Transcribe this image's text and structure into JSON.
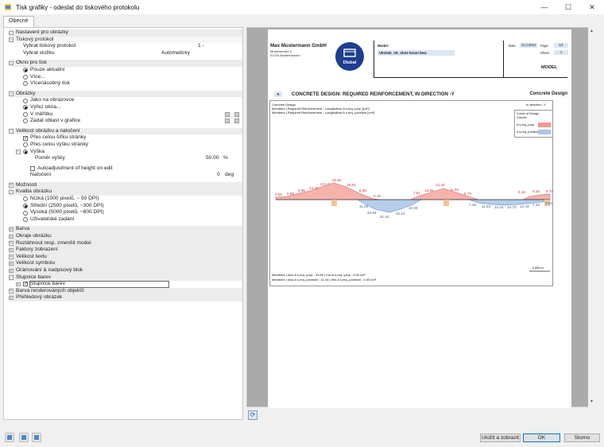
{
  "window": {
    "title": "Tisk grafiky - odeslat do tiskového protokolu",
    "minimize": "—",
    "maximize": "☐",
    "close": "✕"
  },
  "tabs": [
    {
      "label": "Obecné"
    }
  ],
  "settings": {
    "nastaveni": "Nastavení pro obrázky",
    "tiskovy_protokol": "Tiskový protokol",
    "vybrat_protokol": "Vybrat tiskový protokol",
    "vybrat_protokol_val": "1 -",
    "vybrat_slozku": "Vybrat složku",
    "vybrat_slozku_val": "Automaticky",
    "okno_pro_tisk": "Okno pro tisk",
    "pouze_aktualni": "Pouze aktuální",
    "vice": "Více...",
    "vicenasobny": "Vícenásobný tisk",
    "obrazky": "Obrázky",
    "jako_na_obrazovce": "Jako na obrazovce",
    "vyrez_okna": "Výřez okna...",
    "v_meritku": "V měřítku",
    "zadat_oblast": "Zadat oblast v grafice",
    "velikost_obrazku": "Velikost obrázku a natočení",
    "pres_celou_sirku": "Přes celou šířku stránky",
    "pres_celou_vysku": "Přes celou výšku stránky",
    "vyska": "Výška",
    "pomer_vysky": "Poměr výšky",
    "pomer_vysky_val": "50.00",
    "pomer_vysky_unit": "%",
    "autoadjustment": "Autoadjustment of height on edit",
    "natoceni": "Natočení",
    "natoceni_val": "0",
    "natoceni_unit": "deg",
    "moznosti": "Možnosti",
    "kvalita": "Kvalita obrázku",
    "nizka": "Nízká (1000 pixelů, ~ 50 DPI)",
    "stredni": "Střední (2500 pixelů, ~300 DPI)",
    "vysoka": "Vysoká (5000 pixelů, ~600 DPI)",
    "uzivatelske": "Uživatelské zadání",
    "barva": "Barva",
    "okraje": "Okraje obrázku",
    "roztahnout": "Roztáhnout resp. zmenšit model",
    "faktory": "Faktory zobrazení",
    "velikost_textu": "Velikost textu",
    "velikost_symbolu": "Velikost symbolu",
    "oramovani": "Orámování & nadpisový blok",
    "stupnice_barev": "Stupnice barev",
    "stupnice_barev_item": "Stupnice barev",
    "barva_renderovanych": "Barva renderovaných objektů",
    "prehledovy": "Přehledový obrázek"
  },
  "report": {
    "company": "Max Mustermann GmbH",
    "address1": "Musterstraße 5",
    "address2": "01234 Musterhausen",
    "logo_text": "Dlubal",
    "model_label": "Model:",
    "model_value": "VE1025_VE_ohne konst bew",
    "date_label": "Date",
    "date_value": "11.3.2024",
    "page_label": "Page",
    "page_value": "1/1",
    "sheet_label": "Sheet",
    "sheet_value": "1",
    "model_big": "MODEL",
    "section_badge": "A",
    "section_title": "CONCRETE DESIGN: REQUIRED REINFORCEMENT, IN DIRECTION -Y",
    "section_right": "Concrete Design",
    "chart_line1": "Concrete Design",
    "chart_line2": "Members | Required Reinforcement - Longitudinal A s,req,-y,top [cm²]",
    "chart_line3": "Members | Required Reinforcement - Longitudinal A s,req,-y,bottom [cm²]",
    "in_direction": "In direction -Y",
    "legend_title1": "Colors of Design",
    "legend_title2": "Checks",
    "legend_top": "A s,req,-y,top",
    "legend_bottom": "A s,req,-y,bottom",
    "footer1": "Members | max A s,req,-y,top : 33.60 | min A s,req,-y,top : 0.00 cm²",
    "footer2": "Members | max A s,req,-y,bottom : 31.44 | min A s,req,-y,bottom : 0.00 cm²",
    "scale_label": "2.500 m",
    "color_top": "#f19a90",
    "color_bottom": "#a8c7e8"
  },
  "chart_data": {
    "type": "area",
    "title": "CONCRETE DESIGN: REQUIRED REINFORCEMENT, IN DIRECTION -Y",
    "series": [
      {
        "name": "A s,req,-y,top",
        "labels": [
          "0.05",
          "5.96",
          "9.85",
          "14.32",
          "23.17",
          "33.60",
          "19.83",
          "6.68",
          "0.19",
          "7.61",
          "13.56",
          "22.40",
          "11.92",
          "5.70",
          "6.15",
          "6.15",
          "8.78"
        ]
      },
      {
        "name": "A s,req,-y,bottom",
        "labels": [
          "11.26",
          "22.64",
          "31.44",
          "22.13",
          "10.28",
          "7.19",
          "11.40",
          "14.42",
          "14.73",
          "12.43",
          "7.43",
          "3.93"
        ]
      }
    ]
  },
  "footer": {
    "save_show": "Uložit a zobrazit",
    "ok": "OK",
    "cancel": "Storno"
  }
}
